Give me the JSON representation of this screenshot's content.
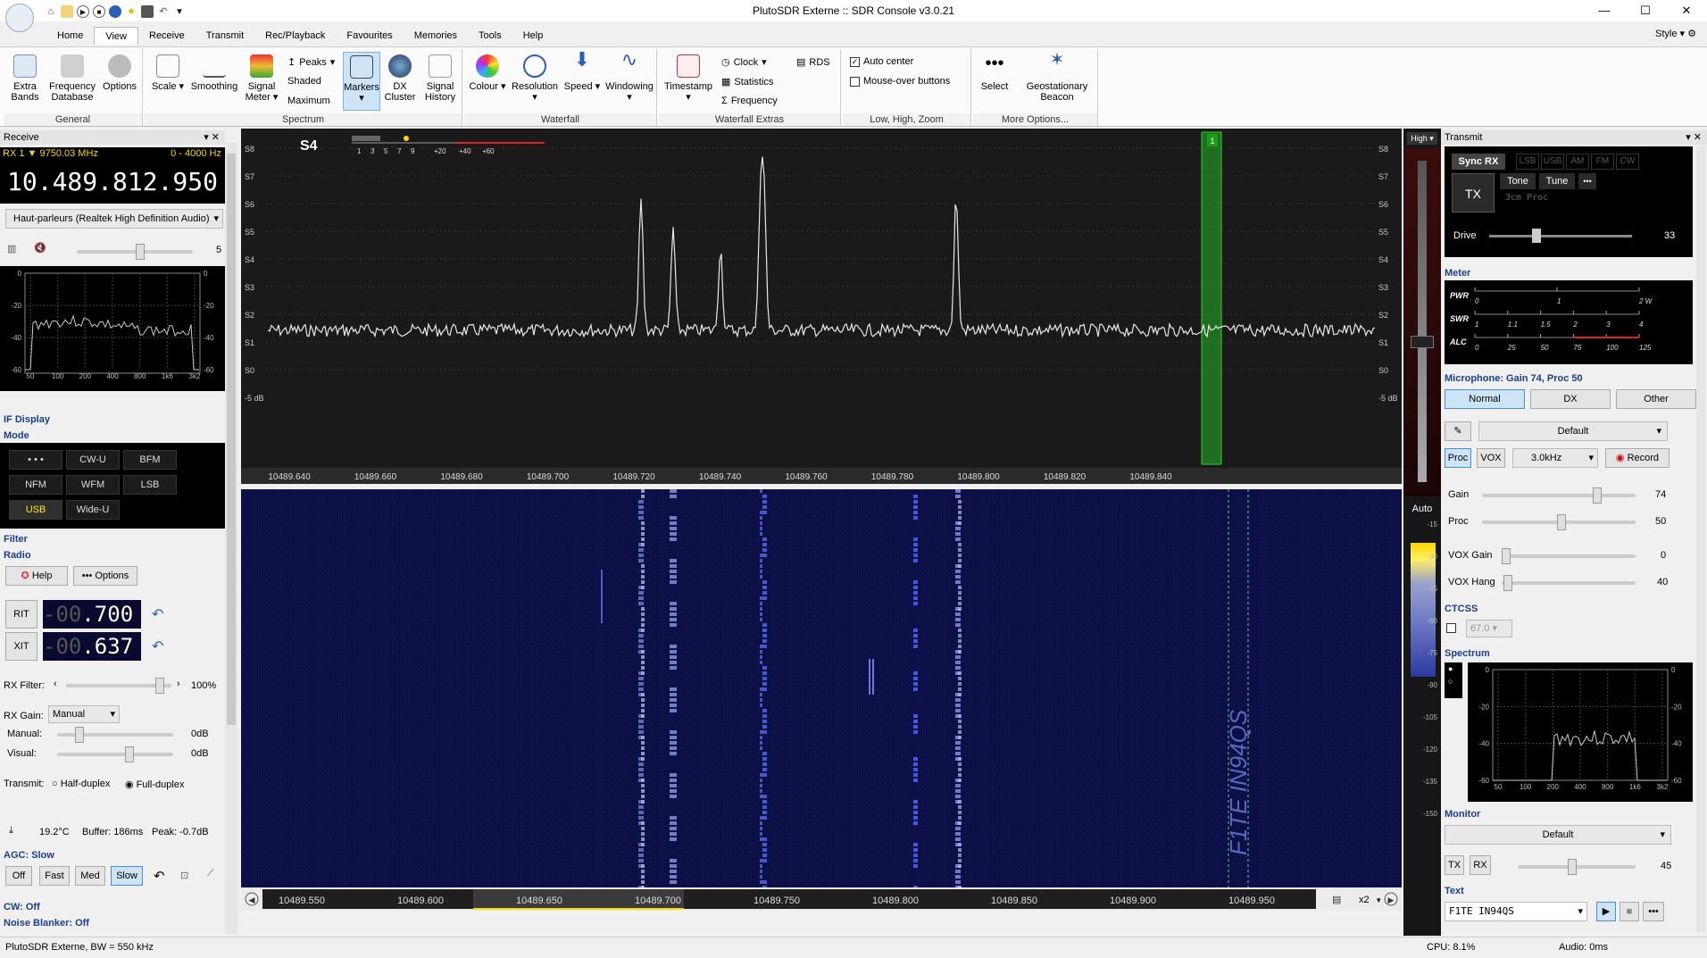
{
  "titlebar": {
    "title": "PlutoSDR Externe :: SDR Console v3.0.21",
    "minimize": "—",
    "maximize": "☐",
    "close": "✕"
  },
  "tabs": [
    "Home",
    "View",
    "Receive",
    "Transmit",
    "Rec/Playback",
    "Favourites",
    "Memories",
    "Tools",
    "Help"
  ],
  "active_tab": "View",
  "style_menu": "Style",
  "ribbon": {
    "general": {
      "label": "General",
      "extra_bands": "Extra Bands",
      "frequency_database": "Frequency Database",
      "options": "Options"
    },
    "spectrum": {
      "label": "Spectrum",
      "scale": "Scale",
      "smoothing": "Smoothing",
      "signal_meter": "Signal Meter",
      "peaks": "Peaks",
      "shaded": "Shaded",
      "maximum": "Maximum",
      "markers": "Markers",
      "dx_cluster": "DX Cluster",
      "signal_history": "Signal History"
    },
    "waterfall": {
      "label": "Waterfall",
      "colour": "Colour",
      "resolution": "Resolution",
      "speed": "Speed",
      "windowing": "Windowing"
    },
    "waterfall_extras": {
      "label": "Waterfall Extras",
      "timestamp": "Timestamp",
      "clock": "Clock",
      "statistics": "Statistics",
      "frequency": "Frequency",
      "rds": "RDS"
    },
    "zoom": {
      "label": "Low, High, Zoom",
      "auto_center": "Auto center",
      "mouse_over": "Mouse-over buttons"
    },
    "more": {
      "label": "More Options...",
      "select": "Select",
      "geo_beacon": "Geostationary Beacon"
    }
  },
  "receive": {
    "header": "Receive",
    "rx_label": "RX 1",
    "rx_center": "▼ 9750.03 MHz",
    "bandwidth": "0 - 4000 Hz",
    "frequency": "10.489.812.950",
    "audio_device": "Haut-parleurs (Realtek High Definition Audio)",
    "volume_value": "5",
    "audio_spectrum_y": [
      "0",
      "-20",
      "-40",
      "-60"
    ],
    "audio_spectrum_x": [
      "50",
      "100",
      "200",
      "400",
      "800",
      "1k6",
      "3k2"
    ],
    "if_display": "IF Display",
    "mode_header": "Mode",
    "modes": [
      "• • •",
      "CW-U",
      "BFM",
      "NFM",
      "WFM",
      "LSB",
      "USB",
      "Wide-U"
    ],
    "active_mode": "USB",
    "filter_header": "Filter",
    "radio_header": "Radio",
    "help": "Help",
    "options": "Options",
    "rit_label": "RIT",
    "rit_dim": "-00",
    "rit_val": ".700",
    "xit_label": "XIT",
    "xit_dim": "-00",
    "xit_val": ".637",
    "rx_filter_label": "RX Filter:",
    "rx_filter_value": "100%",
    "rx_gain_label": "RX Gain:",
    "rx_gain_mode": "Manual",
    "manual_label": "Manual:",
    "manual_value": "0dB",
    "visual_label": "Visual:",
    "visual_value": "0dB",
    "transmit_label": "Transmit:",
    "half_duplex": "Half-duplex",
    "full_duplex": "Full-duplex",
    "temperature": "19.2°C",
    "buffer": "Buffer: 186ms",
    "peak": "Peak: -0.7dB",
    "agc_header": "AGC: Slow",
    "agc_buttons": [
      "Off",
      "Fast",
      "Med",
      "Slow"
    ],
    "agc_active": "Slow",
    "cw_header": "CW: Off",
    "nb_header": "Noise Blanker: Off"
  },
  "spectrum": {
    "s_reading": "S4",
    "s_scale_left": [
      "S8",
      "S7",
      "S6",
      "S5",
      "S4",
      "S3",
      "S2",
      "S1",
      "S0",
      "-5 dB"
    ],
    "s_meter_ticks": [
      "1",
      "3",
      "5",
      "7",
      "9",
      "+20",
      "+40",
      "+60"
    ],
    "freq_ticks": [
      "10489.640",
      "10489.660",
      "10489.680",
      "10489.700",
      "10489.720",
      "10489.740",
      "10489.760",
      "10489.780",
      "10489.800",
      "10489.820",
      "10489.840"
    ],
    "marker_label": "1",
    "high_btn": "High ▾",
    "auto_btn": "Auto",
    "accent_green": "#2bd42b"
  },
  "waterfall": {
    "freq_ticks": [
      "10489.550",
      "10489.600",
      "10489.650",
      "10489.700",
      "10489.750",
      "10489.800",
      "10489.850",
      "10489.900",
      "10489.950"
    ],
    "zoom": "x2",
    "beacon_text": "F1TE IN94QS",
    "scale": [
      "-15",
      "-30",
      "-45",
      "-60",
      "-75",
      "-90",
      "-105",
      "-120",
      "-135",
      "-150"
    ]
  },
  "transmit": {
    "header": "Transmit",
    "sync_rx": "Sync RX",
    "modes": [
      "LSB",
      "USB",
      "AM",
      "FM",
      "CW"
    ],
    "tx": "TX",
    "tone": "Tone",
    "tune": "Tune",
    "more": "•••",
    "proc_text": "3cm Proc",
    "drive_label": "Drive",
    "drive_value": "33",
    "meter_header": "Meter",
    "meter_rows": [
      {
        "label": "PWR",
        "ticks": [
          "0",
          "1",
          "2 W"
        ]
      },
      {
        "label": "SWR",
        "ticks": [
          "1",
          "1.1",
          "1.5",
          "2",
          "3",
          "4"
        ]
      },
      {
        "label": "ALC",
        "ticks": [
          "0",
          "25",
          "50",
          "75",
          "100",
          "125"
        ]
      }
    ],
    "mic_header": "Microphone: Gain 74, Proc 50",
    "mic_tabs": [
      "Normal",
      "DX",
      "Other"
    ],
    "mic_profile": "Default",
    "proc": "Proc",
    "vox": "VOX",
    "bandwidth": "3.0kHz",
    "record": "Record",
    "gain_label": "Gain",
    "gain_value": "74",
    "proc_label": "Proc",
    "proc_value": "50",
    "vox_gain_label": "VOX Gain",
    "vox_gain_value": "0",
    "vox_hang_label": "VOX Hang",
    "vox_hang_value": "40",
    "ctcss_header": "CTCSS",
    "ctcss_value": "67.0",
    "spectrum_header": "Spectrum",
    "tx_spectrum_y": [
      "0",
      "-20",
      "-40",
      "-60"
    ],
    "tx_spectrum_x": [
      "50",
      "100",
      "200",
      "400",
      "800",
      "1k6",
      "3k2"
    ],
    "monitor_header": "Monitor",
    "monitor_profile": "Default",
    "monitor_tx": "TX",
    "monitor_rx": "RX",
    "monitor_value": "45",
    "text_header": "Text",
    "text_value": "F1TE IN94QS"
  },
  "status": {
    "left": "PlutoSDR Externe, BW = 550 kHz",
    "cpu": "CPU: 8.1%",
    "audio": "Audio: 0ms"
  }
}
